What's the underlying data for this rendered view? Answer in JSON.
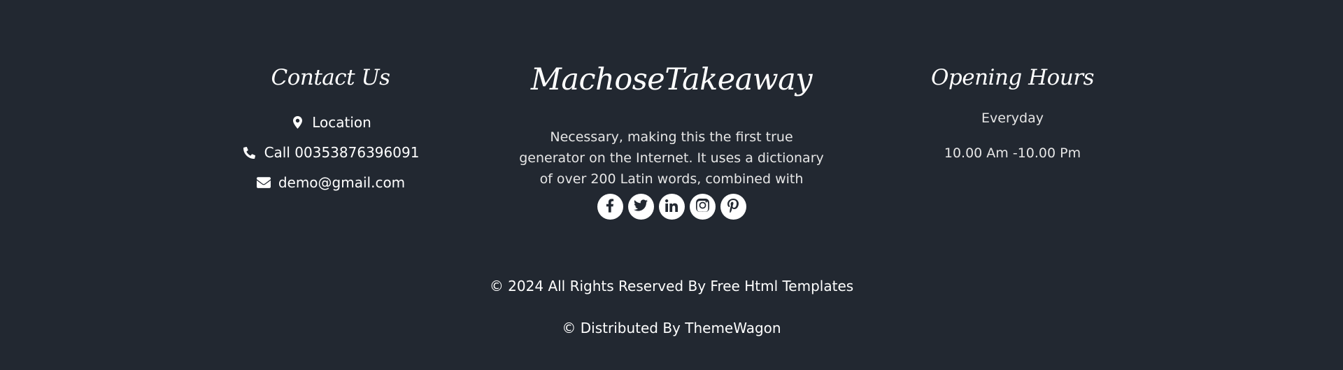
{
  "contact": {
    "heading": "Contact Us",
    "location_label": "Location",
    "call_label": "Call 00353876396091",
    "email_label": "demo@gmail.com"
  },
  "brand": {
    "name": "MachoseTakeaway",
    "description": "Necessary, making this the first true generator on the Internet. It uses a dictionary of over 200 Latin words, combined with",
    "socials": [
      "facebook-icon",
      "twitter-icon",
      "linkedin-icon",
      "instagram-icon",
      "pinterest-icon"
    ]
  },
  "hours": {
    "heading": "Opening Hours",
    "days": "Everyday",
    "time": "10.00 Am -10.00 Pm"
  },
  "copyright": {
    "line1_prefix": "© 2024 All Rights Reserved By ",
    "line1_link": "Free Html Templates",
    "line2_prefix": "© Distributed By ",
    "line2_link": "ThemeWagon"
  },
  "colors": {
    "background": "#222831",
    "text": "#ffffff",
    "icon_circle": "#ffffff"
  }
}
